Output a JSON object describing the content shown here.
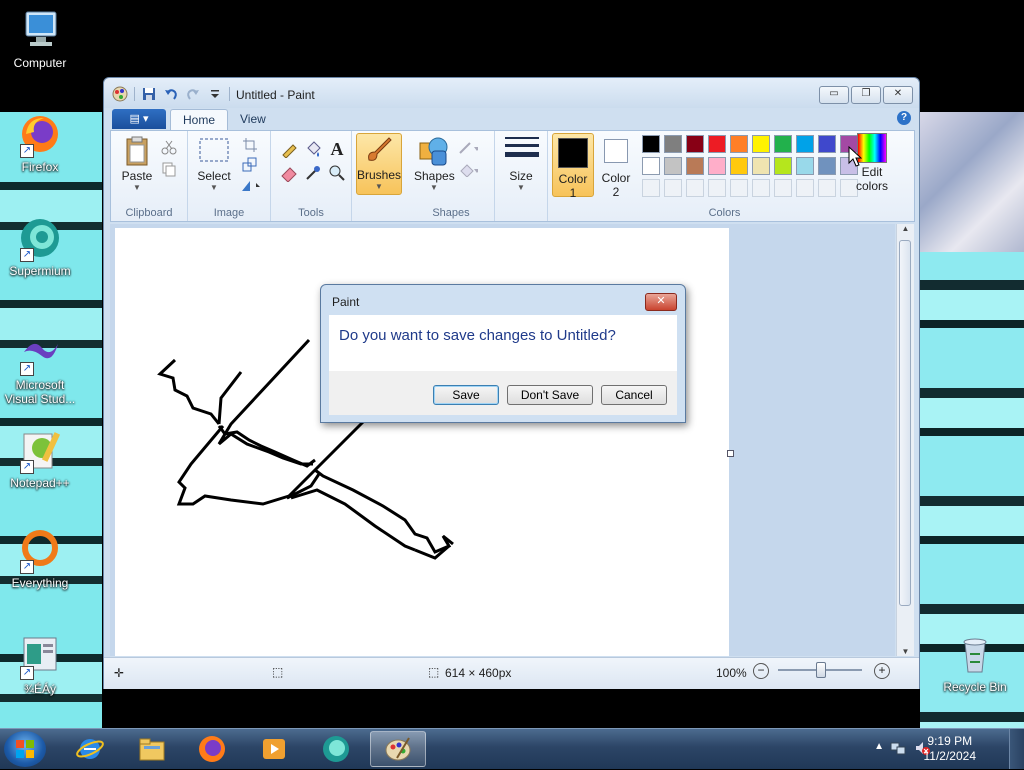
{
  "desktop": {
    "icons": [
      {
        "label": "Computer"
      },
      {
        "label": "Firefox"
      },
      {
        "label": "Supermium"
      },
      {
        "label": "Microsoft Visual Stud..."
      },
      {
        "label": "Notepad++"
      },
      {
        "label": "Everything"
      },
      {
        "label": "¾ÉÁý"
      },
      {
        "label": "Recycle Bin"
      }
    ]
  },
  "window": {
    "title": "Untitled - Paint",
    "tabs": {
      "file": "",
      "home": "Home",
      "view": "View"
    },
    "ribbon": {
      "clipboard": {
        "group": "Clipboard",
        "paste": "Paste"
      },
      "image": {
        "group": "Image",
        "select": "Select"
      },
      "tools": {
        "group": "Tools"
      },
      "brushes": "Brushes",
      "shapes": {
        "group": "Shapes",
        "label": "Shapes"
      },
      "size": "Size",
      "colors": {
        "group": "Colors",
        "color1": "Color",
        "color1_num": "1",
        "color2": "Color",
        "color2_num": "2",
        "edit": "Edit",
        "edit2": "colors",
        "row1": [
          "#000000",
          "#7f7f7f",
          "#880015",
          "#ed1c24",
          "#ff7f27",
          "#fff200",
          "#22b14c",
          "#00a2e8",
          "#3f48cc",
          "#a349a4"
        ],
        "row2": [
          "#ffffff",
          "#c3c3c3",
          "#b97a57",
          "#ffaec9",
          "#ffc90e",
          "#efe4b0",
          "#b5e61d",
          "#99d9ea",
          "#7092be",
          "#c8bfe7"
        ]
      }
    },
    "status": {
      "size": "614 × 460px",
      "zoom": "100%"
    }
  },
  "dialog": {
    "title": "Paint",
    "message": "Do you want to save changes to Untitled?",
    "save": "Save",
    "dont_save": "Don't Save",
    "cancel": "Cancel"
  },
  "taskbar": {
    "time": "9:19 PM",
    "date": "11/2/2024"
  }
}
